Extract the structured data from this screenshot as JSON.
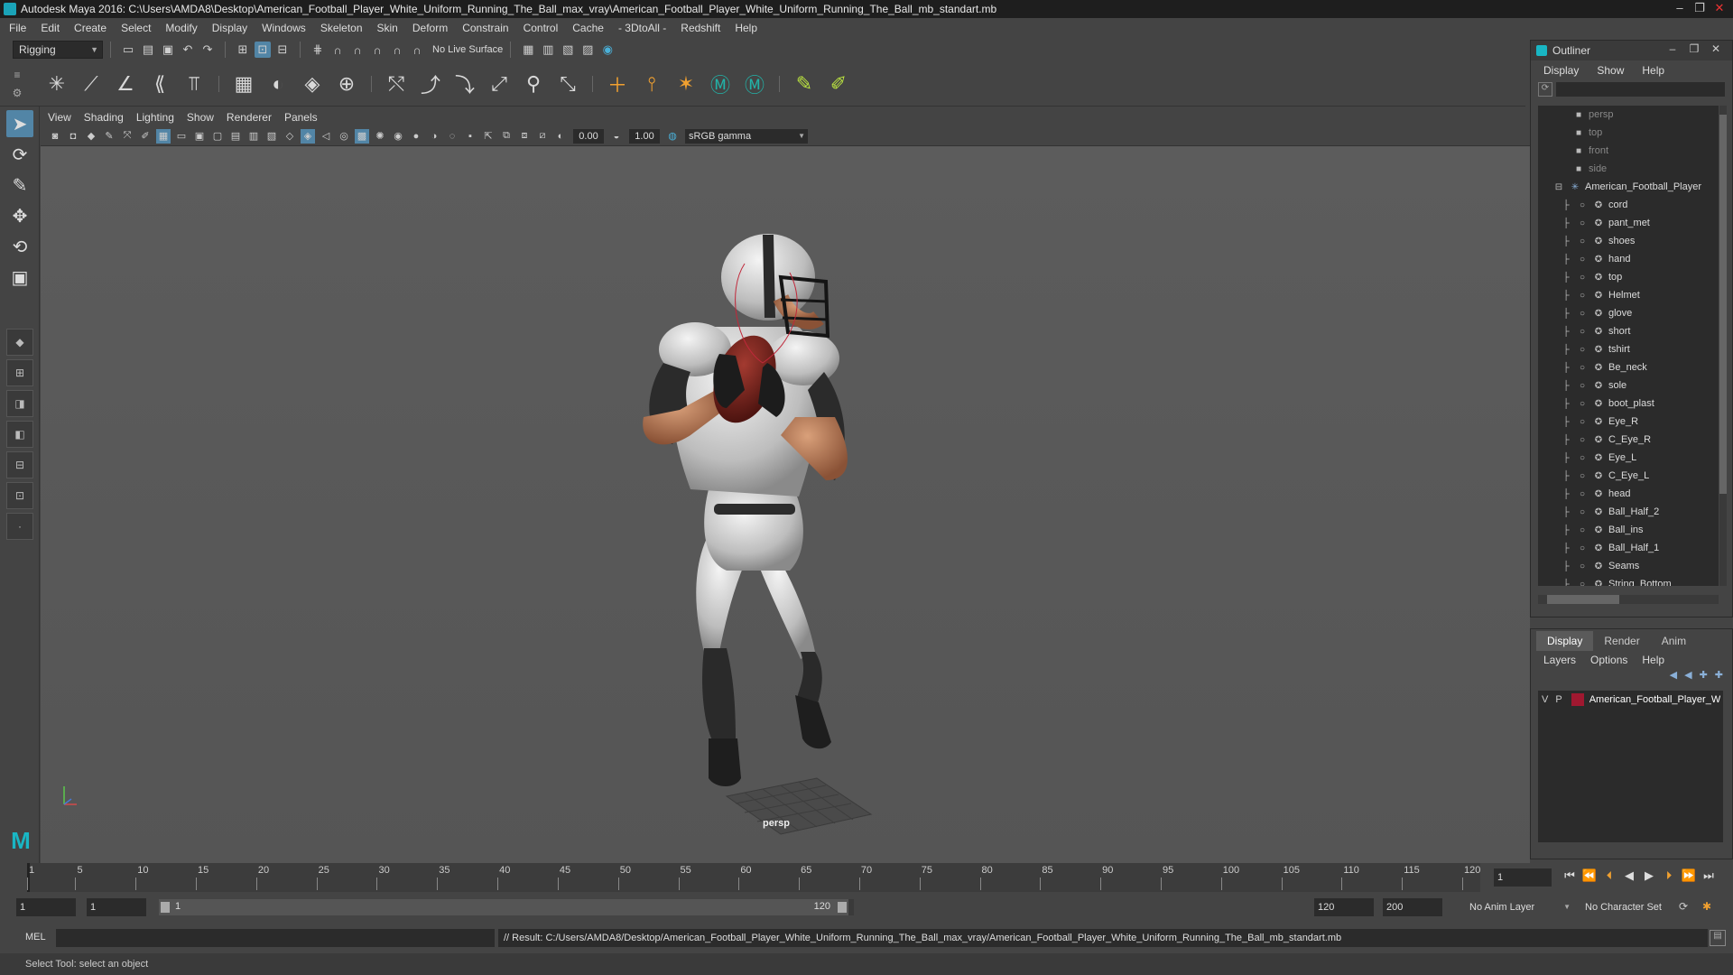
{
  "window": {
    "title": "Autodesk Maya 2016: C:\\Users\\AMDA8\\Desktop\\American_Football_Player_White_Uniform_Running_The_Ball_max_vray\\American_Football_Player_White_Uniform_Running_The_Ball_mb_standart.mb"
  },
  "menubar": [
    "File",
    "Edit",
    "Create",
    "Select",
    "Modify",
    "Display",
    "Windows",
    "Skeleton",
    "Skin",
    "Deform",
    "Constrain",
    "Control",
    "Cache",
    "- 3DtoAll -",
    "Redshift",
    "Help"
  ],
  "statusline": {
    "mode": "Rigging",
    "live_surface": "No Live Surface"
  },
  "panel": {
    "menus": [
      "View",
      "Shading",
      "Lighting",
      "Show",
      "Renderer",
      "Panels"
    ],
    "exposure": "0.00",
    "gamma_value": "1.00",
    "color_space": "sRGB gamma",
    "camera_label": "persp"
  },
  "outliner": {
    "title": "Outliner",
    "menus": [
      "Display",
      "Show",
      "Help"
    ],
    "cameras": [
      "persp",
      "top",
      "front",
      "side"
    ],
    "root": "American_Football_Player",
    "children": [
      "cord",
      "pant_met",
      "shoes",
      "hand",
      "top",
      "Helmet",
      "glove",
      "short",
      "tshirt",
      "Be_neck",
      "sole",
      "boot_plast",
      "Eye_R",
      "C_Eye_R",
      "Eye_L",
      "C_Eye_L",
      "head",
      "Ball_Half_2",
      "Ball_ins",
      "Ball_Half_1",
      "Seams",
      "String_Bottom"
    ]
  },
  "layers": {
    "tabs": [
      "Display",
      "Render",
      "Anim"
    ],
    "active_tab": "Display",
    "menus": [
      "Layers",
      "Options",
      "Help"
    ],
    "rows": [
      {
        "v": "V",
        "p": "P",
        "color": "#a01830",
        "name": "American_Football_Player_W"
      }
    ]
  },
  "timeline": {
    "ticks": [
      "1",
      "5",
      "10",
      "15",
      "20",
      "25",
      "30",
      "35",
      "40",
      "45",
      "50",
      "55",
      "60",
      "65",
      "70",
      "75",
      "80",
      "85",
      "90",
      "95",
      "100",
      "105",
      "110",
      "115",
      "120"
    ],
    "tick_values": [
      1,
      5,
      10,
      15,
      20,
      25,
      30,
      35,
      40,
      45,
      50,
      55,
      60,
      65,
      70,
      75,
      80,
      85,
      90,
      95,
      100,
      105,
      110,
      115,
      120
    ],
    "min": 1,
    "max": 120,
    "current_frame": "1"
  },
  "range": {
    "start": "1",
    "playback_start": "1",
    "slider_start": "1",
    "slider_end": "120",
    "playback_end": "120",
    "end": "200",
    "anim_layer": "No Anim Layer",
    "character_set": "No Character Set"
  },
  "cmdline": {
    "label": "MEL",
    "result": "// Result: C:/Users/AMDA8/Desktop/American_Football_Player_White_Uniform_Running_The_Ball_max_vray/American_Football_Player_White_Uniform_Running_The_Ball_mb_standart.mb"
  },
  "helpline": "Select Tool: select an object"
}
